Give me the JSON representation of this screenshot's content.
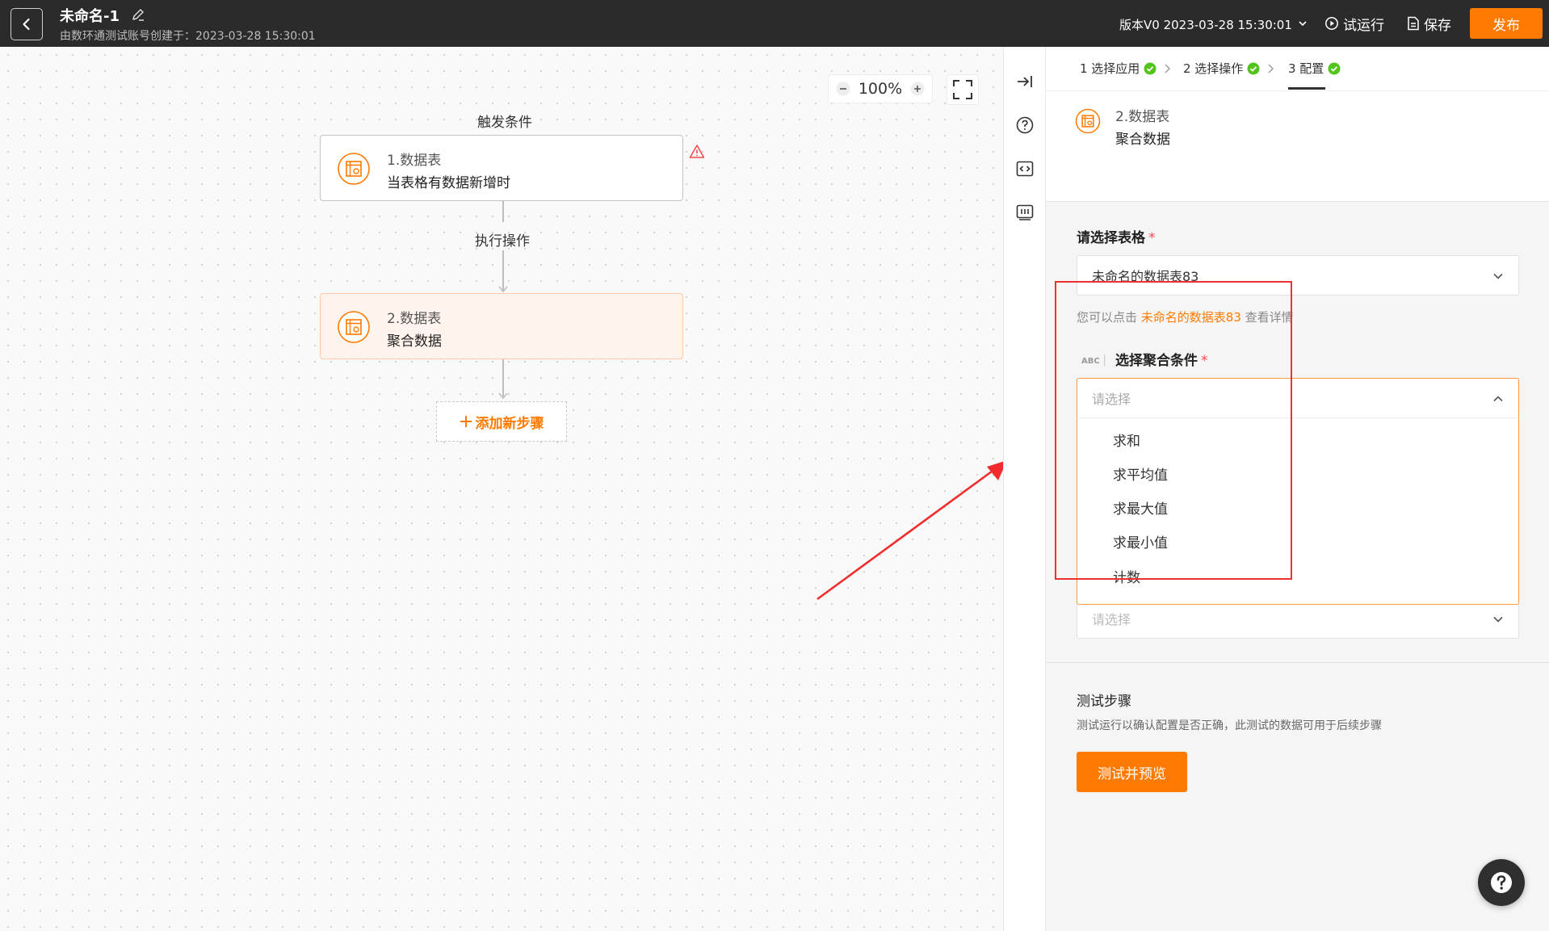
{
  "header": {
    "title": "未命名-1",
    "subtitle": "由数环通测试账号创建于：2023-03-28 15:30:01",
    "version": "版本V0 2023-03-28 15:30:01",
    "run_label": "试运行",
    "save_label": "保存",
    "publish_label": "发布"
  },
  "canvas": {
    "zoom": "100%",
    "trigger_label": "触发条件",
    "exec_label": "执行操作",
    "nodes": [
      {
        "line1": "1.数据表",
        "line2": "当表格有数据新增时"
      },
      {
        "line1": "2.数据表",
        "line2": "聚合数据"
      }
    ],
    "add_step_label": "添加新步骤"
  },
  "panel": {
    "steps": [
      {
        "label": "1 选择应用",
        "done": true
      },
      {
        "label": "2 选择操作",
        "done": true
      },
      {
        "label": "3 配置",
        "done": true
      }
    ],
    "node": {
      "line1": "2.数据表",
      "line2": "聚合数据"
    },
    "table_field": {
      "label": "请选择表格",
      "value": "未命名的数据表83",
      "hint_prefix": "您可以点击",
      "hint_link": "未命名的数据表83",
      "hint_suffix": "查看详情"
    },
    "agg_field": {
      "badge": "ABC",
      "label": "选择聚合条件",
      "placeholder": "请选择",
      "options": [
        "求和",
        "求平均值",
        "求最大值",
        "求最小值",
        "计数"
      ]
    },
    "next_field": {
      "placeholder": "请选择"
    },
    "test": {
      "title": "测试步骤",
      "desc": "测试运行以确认配置是否正确，此测试的数据可用于后续步骤",
      "button_label": "测试并预览"
    }
  },
  "colors": {
    "accent": "#ff7a00",
    "topbar": "#2b2b2b",
    "success": "#52c41a",
    "highlight": "#f03030"
  },
  "icons": [
    "back-icon",
    "edit-icon",
    "play-icon",
    "document-icon",
    "minus-icon",
    "plus-icon",
    "fullscreen-icon",
    "datatable-icon",
    "warning-icon",
    "collapse-right-icon",
    "help-icon",
    "code-icon",
    "log-icon",
    "check-circle-icon",
    "chevron-down-icon",
    "chevron-up-icon",
    "question-icon"
  ]
}
